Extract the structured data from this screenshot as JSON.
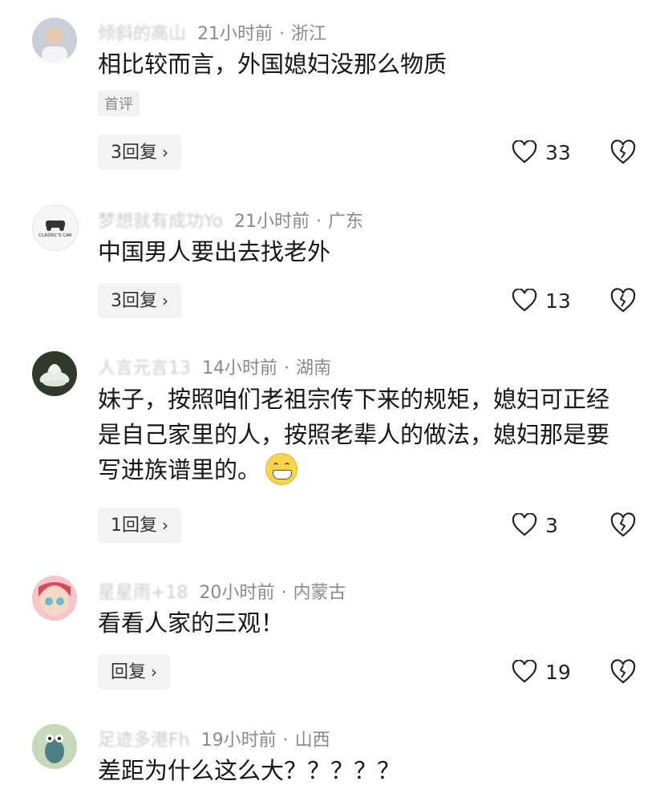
{
  "comments": [
    {
      "username": "倾斜的高山",
      "time": "21小时前",
      "location": "浙江",
      "text": "相比较而言，外国媳妇没那么物质",
      "tag": "首评",
      "reply_label": "3回复",
      "likes": "33"
    },
    {
      "username": "梦想就有成功Yo",
      "time": "21小时前",
      "location": "广东",
      "avatar_text": "CLASSIC'S CAR",
      "text": "中国男人要出去找老外",
      "reply_label": "3回复",
      "likes": "13"
    },
    {
      "username": "人言元言13",
      "time": "14小时前",
      "location": "湖南",
      "text": "妹子，按照咱们老祖宗传下来的规矩，媳妇可正经是自己家里的人，按照老辈人的做法，媳妇那是要写进族谱里的。",
      "emoji": "grinning-emoji",
      "reply_label": "1回复",
      "likes": "3"
    },
    {
      "username": "星星雨+18",
      "time": "20小时前",
      "location": "内蒙古",
      "text": "看看人家的三观！",
      "reply_label": "回复",
      "likes": "19"
    },
    {
      "username": "足迹多港Fh",
      "time": "19小时前",
      "location": "山西",
      "text": "差距为什么这么大？？？？？"
    }
  ],
  "separator": "·",
  "chevron": "›",
  "colors": {
    "meta": "#8a8a8a",
    "text": "#161616",
    "button_bg": "#f3f3f3"
  }
}
